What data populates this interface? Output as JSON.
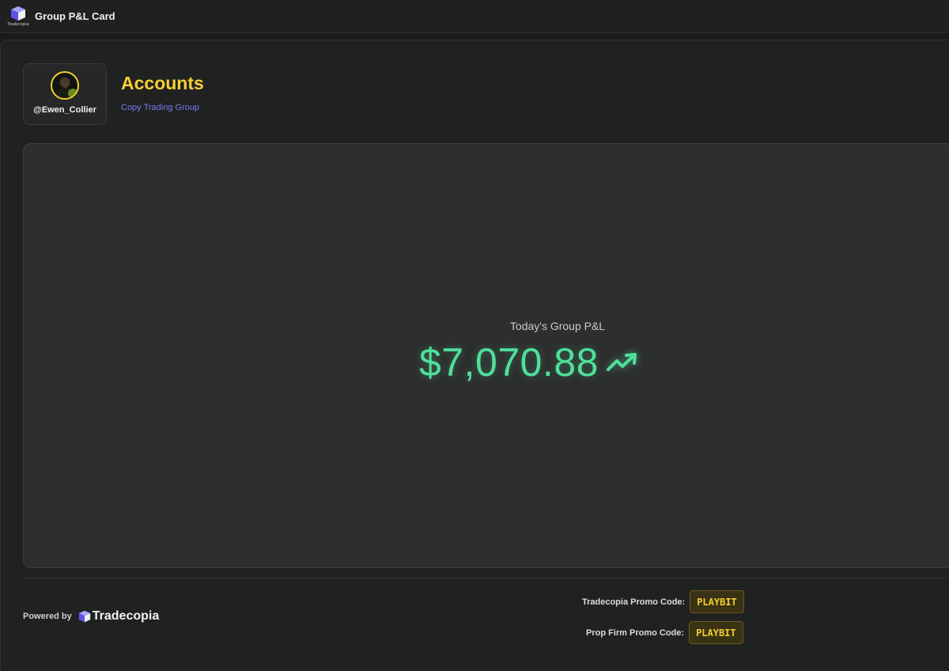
{
  "window": {
    "title": "Group P&L Card",
    "logo_text": "Tradecopia"
  },
  "profile": {
    "username": "@Ewen_Collier",
    "group_name": "Accounts",
    "group_type": "Copy Trading Group"
  },
  "pnl": {
    "label": "Today's Group P&L",
    "value": "$7,070.88",
    "trend": "up"
  },
  "footer": {
    "powered_by": "Powered by",
    "brand": "Tradecopia",
    "promos": [
      {
        "label": "Tradecopia Promo Code:",
        "code": "PLAYBIT"
      },
      {
        "label": "Prop Firm Promo Code:",
        "code": "PLAYBIT"
      }
    ]
  },
  "colors": {
    "accent_yellow": "#f6cf36",
    "accent_purple": "#7b78f0",
    "profit_green": "#4fe09c"
  },
  "icons": {
    "app_logo": "tradecopia-cube-icon",
    "trend": "trending-up-icon"
  }
}
